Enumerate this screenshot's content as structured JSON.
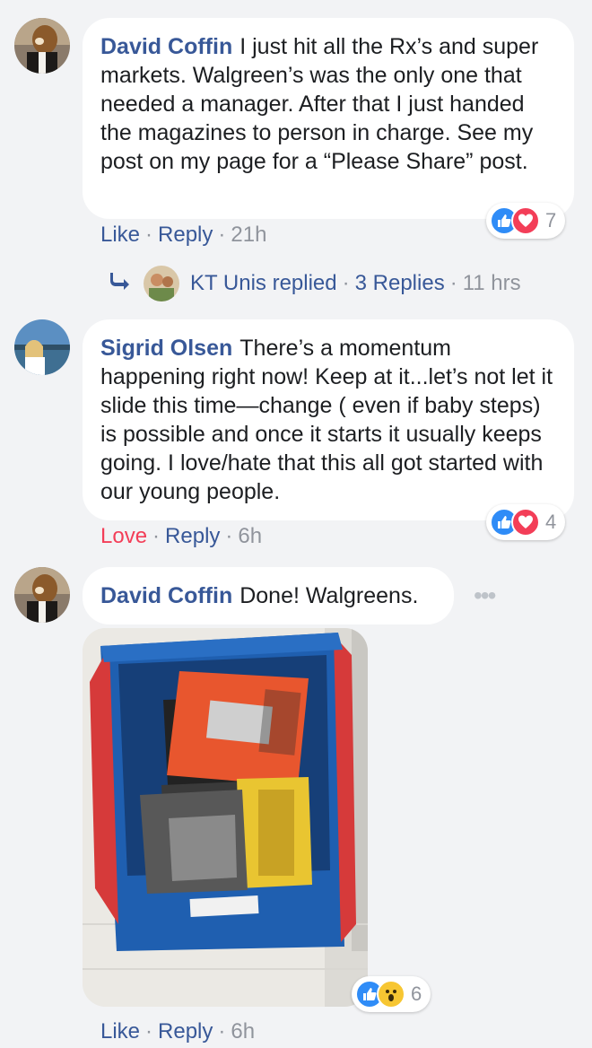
{
  "comments": [
    {
      "author": "David Coffin",
      "text": "I just hit all the Rx’s and super markets. Walgreen’s was the only one that needed a manager. After that I just handed the magazines to person in charge. See my post on my page for a “Please Share” post.",
      "action_primary": "Like",
      "action_reply": "Reply",
      "time": "21h",
      "reaction_count": "7",
      "reactions": [
        "like-icon",
        "love-icon"
      ]
    },
    {
      "author": "Sigrid Olsen",
      "text": "There’s a momentum happening right now! Keep at it...let’s not let it slide this time—change ( even if baby steps) is possible and once it starts it usually keeps going. I love/hate that this all got started with our young people.",
      "action_primary": "Love",
      "action_reply": "Reply",
      "time": "6h",
      "reaction_count": "4",
      "reactions": [
        "like-icon",
        "love-icon"
      ]
    },
    {
      "author": "David Coffin",
      "text": "Done! Walgreens.",
      "action_primary": "Like",
      "action_reply": "Reply",
      "time": "6h",
      "reaction_count": "6",
      "reactions": [
        "like-icon",
        "wow-icon"
      ],
      "more": "•••"
    }
  ],
  "replies": {
    "name": "KT Unis replied",
    "count": "3 Replies",
    "time": "11 hrs"
  },
  "separator": "·",
  "colors": {
    "link": "#385898",
    "love": "#f33e58",
    "muted": "#90949c",
    "like_blue": "#2f8cf7",
    "background": "#f2f3f5"
  }
}
